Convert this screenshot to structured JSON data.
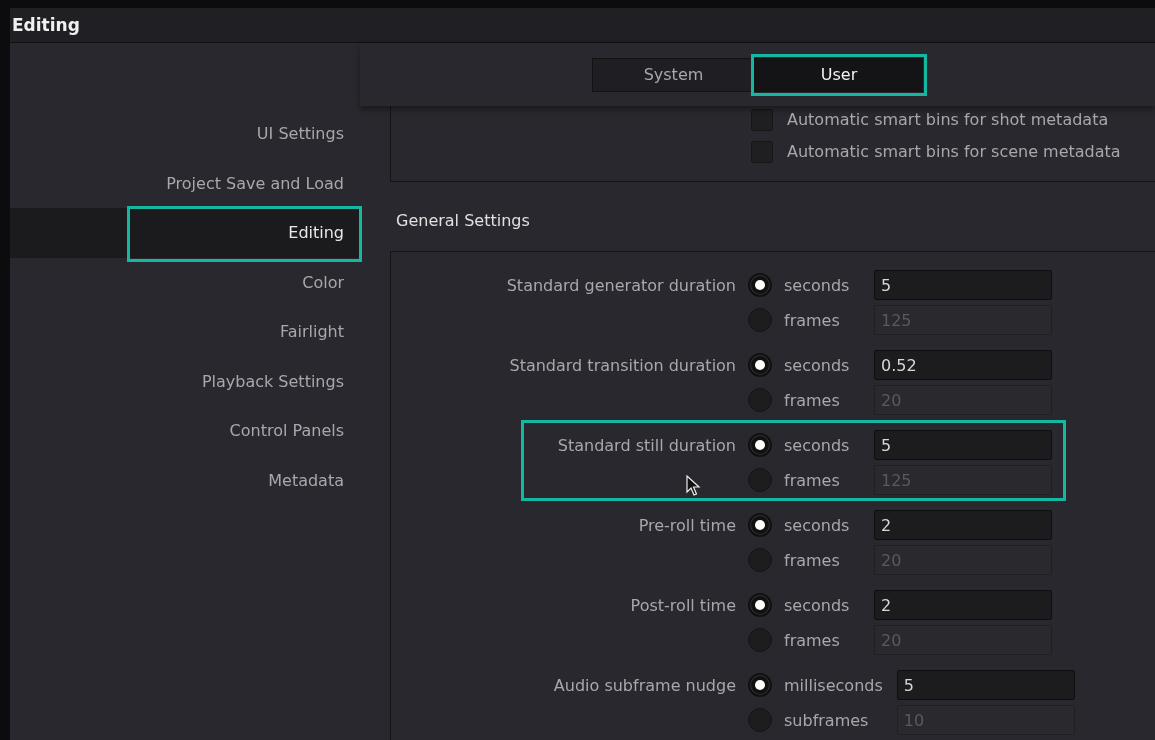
{
  "window": {
    "title": "Editing"
  },
  "tabs": [
    {
      "label": "System",
      "selected": false,
      "highlighted": false
    },
    {
      "label": "User",
      "selected": true,
      "highlighted": true
    }
  ],
  "sidebar": {
    "items": [
      {
        "label": "UI Settings",
        "selected": false,
        "highlighted": false
      },
      {
        "label": "Project Save and Load",
        "selected": false,
        "highlighted": false
      },
      {
        "label": "Editing",
        "selected": true,
        "highlighted": true
      },
      {
        "label": "Color",
        "selected": false,
        "highlighted": false
      },
      {
        "label": "Fairlight",
        "selected": false,
        "highlighted": false
      },
      {
        "label": "Playback Settings",
        "selected": false,
        "highlighted": false
      },
      {
        "label": "Control Panels",
        "selected": false,
        "highlighted": false
      },
      {
        "label": "Metadata",
        "selected": false,
        "highlighted": false
      }
    ]
  },
  "smart_bins": [
    {
      "label": "Automatic smart bins for shot metadata",
      "checked": false
    },
    {
      "label": "Automatic smart bins for scene metadata",
      "checked": false
    }
  ],
  "general_settings": {
    "title": "General Settings",
    "settings": [
      {
        "label": "Standard generator duration",
        "highlighted": false,
        "options": [
          {
            "label": "seconds",
            "selected": true,
            "value": "5"
          },
          {
            "label": "frames",
            "selected": false,
            "value": "125"
          }
        ]
      },
      {
        "label": "Standard transition duration",
        "highlighted": false,
        "options": [
          {
            "label": "seconds",
            "selected": true,
            "value": "0.52"
          },
          {
            "label": "frames",
            "selected": false,
            "value": "20"
          }
        ]
      },
      {
        "label": "Standard still duration",
        "highlighted": true,
        "options": [
          {
            "label": "seconds",
            "selected": true,
            "value": "5"
          },
          {
            "label": "frames",
            "selected": false,
            "value": "125"
          }
        ]
      },
      {
        "label": "Pre-roll time",
        "highlighted": false,
        "options": [
          {
            "label": "seconds",
            "selected": true,
            "value": "2"
          },
          {
            "label": "frames",
            "selected": false,
            "value": "20"
          }
        ]
      },
      {
        "label": "Post-roll time",
        "highlighted": false,
        "options": [
          {
            "label": "seconds",
            "selected": true,
            "value": "2"
          },
          {
            "label": "frames",
            "selected": false,
            "value": "20"
          }
        ]
      },
      {
        "label": "Audio subframe nudge",
        "highlighted": false,
        "options": [
          {
            "label": "milliseconds",
            "selected": true,
            "value": "5"
          },
          {
            "label": "subframes",
            "selected": false,
            "value": "10"
          }
        ]
      }
    ]
  }
}
